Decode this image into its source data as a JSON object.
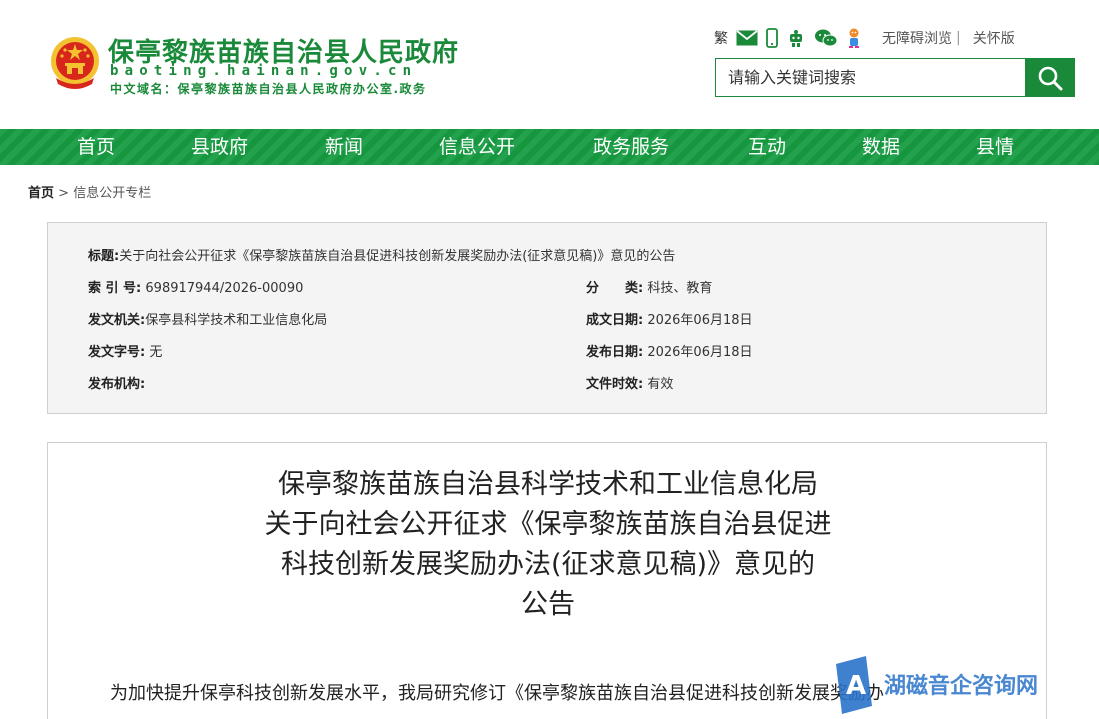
{
  "header": {
    "title": "保亭黎族苗族自治县人民政府",
    "domain": "baoting.hainan.gov.cn",
    "cn_domain": "中文域名：保亭黎族苗族自治县人民政府办公室.政务",
    "tools": {
      "traditional": "繁",
      "icons": [
        "mail-icon",
        "mobile-icon",
        "robot-icon",
        "wechat-icon",
        "mascot-icon"
      ],
      "accessibility": "无障碍浏览",
      "separator": "|",
      "care_mode": "关怀版"
    },
    "search": {
      "placeholder": "请输入关键词搜索"
    }
  },
  "nav": {
    "items": [
      {
        "label": "首页"
      },
      {
        "label": "县政府"
      },
      {
        "label": "新闻"
      },
      {
        "label": "信息公开"
      },
      {
        "label": "政务服务"
      },
      {
        "label": "互动"
      },
      {
        "label": "数据"
      },
      {
        "label": "县情"
      }
    ]
  },
  "breadcrumb": {
    "home": "首页",
    "sep": ">",
    "current": "信息公开专栏"
  },
  "meta": {
    "title_label": "标题:",
    "title_value": "关于向社会公开征求《保亭黎族苗族自治县促进科技创新发展奖励办法(征求意见稿)》意见的公告",
    "index_label": "索 引 号:",
    "index_value": "698917944/2026-00090",
    "category_label": "分　　类:",
    "category_value": "科技、教育",
    "issuer_label": "发文机关:",
    "issuer_value": "保亭县科学技术和工业信息化局",
    "written_date_label": "成文日期:",
    "written_date_value": "2026年06月18日",
    "doc_no_label": "发文字号:",
    "doc_no_value": "无",
    "publish_date_label": "发布日期:",
    "publish_date_value": "2026年06月18日",
    "publisher_label": "发布机构:",
    "publisher_value": "",
    "validity_label": "文件时效:",
    "validity_value": "有效"
  },
  "article": {
    "title_lines": [
      "保亭黎族苗族自治县科学技术和工业信息化局",
      "关于向社会公开征求《保亭黎族苗族自治县促进",
      "科技创新发展奖励办法(征求意见稿)》意见的",
      "公告"
    ],
    "body_first_line": "为加快提升保亭科技创新发展水平，我局研究修订《保亭黎族苗族自治县促进科技创新发展奖励办"
  },
  "watermark": {
    "text": "湖磁音企咨询网"
  },
  "colors": {
    "brand_green": "#1a8a3a",
    "nav_green": "#189c43",
    "emblem_red": "#d8261c",
    "emblem_gold": "#f2c230"
  }
}
